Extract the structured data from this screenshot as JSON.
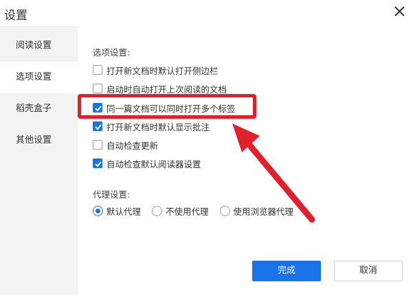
{
  "window": {
    "title": "设置",
    "close_icon": "close-icon"
  },
  "sidebar": {
    "items": [
      {
        "label": "阅读设置",
        "active": false
      },
      {
        "label": "选项设置",
        "active": true
      },
      {
        "label": "稻壳盒子",
        "active": false
      },
      {
        "label": "其他设置",
        "active": false
      }
    ]
  },
  "options": {
    "section_label": "选项设置:",
    "items": [
      {
        "label": "打开新文档时默认打开侧边栏",
        "checked": false
      },
      {
        "label": "启动时自动打开上次阅读的文档",
        "checked": false
      },
      {
        "label": "同一篇文档可以同时打开多个标签",
        "checked": true
      },
      {
        "label": "打开新文档时默认显示批注",
        "checked": true
      },
      {
        "label": "自动检查更新",
        "checked": false
      },
      {
        "label": "自动检查默认阅读器设置",
        "checked": true
      }
    ]
  },
  "proxy": {
    "section_label": "代理设置:",
    "options": [
      {
        "label": "默认代理",
        "selected": true
      },
      {
        "label": "不使用代理",
        "selected": false
      },
      {
        "label": "使用浏览器代理",
        "selected": false
      }
    ]
  },
  "buttons": {
    "ok": "完成",
    "cancel": "取消"
  },
  "colors": {
    "accent": "#1a73e8",
    "annotation": "#e0202b"
  }
}
